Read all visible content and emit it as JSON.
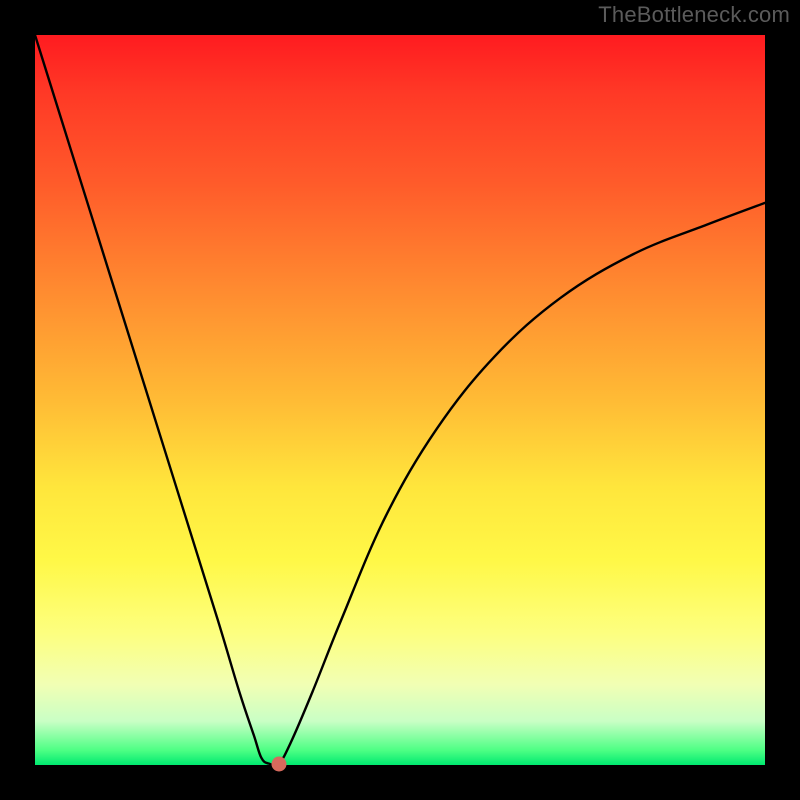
{
  "watermark": "TheBottleneck.com",
  "chart_data": {
    "type": "line",
    "title": "",
    "xlabel": "",
    "ylabel": "",
    "xlim": [
      0,
      100
    ],
    "ylim": [
      0,
      100
    ],
    "series": [
      {
        "name": "bottleneck-curve",
        "x": [
          0,
          5,
          10,
          15,
          20,
          25,
          28,
          30,
          31,
          32,
          33.4,
          35,
          38,
          42,
          48,
          55,
          63,
          72,
          82,
          92,
          100
        ],
        "y": [
          100,
          84,
          68,
          52,
          36,
          20,
          10,
          4,
          1,
          0.2,
          0.2,
          3,
          10,
          20,
          34,
          46,
          56,
          64,
          70,
          74,
          77
        ]
      }
    ],
    "annotations": [
      {
        "type": "point",
        "name": "marker-dot",
        "x": 33.4,
        "y": 0.2,
        "color": "#d66a5d"
      }
    ],
    "gradient_background": {
      "top_color": "#ff1b20",
      "bottom_color": "#00e970",
      "description": "vertical red-to-green heat gradient"
    },
    "frame_color": "#000000"
  }
}
